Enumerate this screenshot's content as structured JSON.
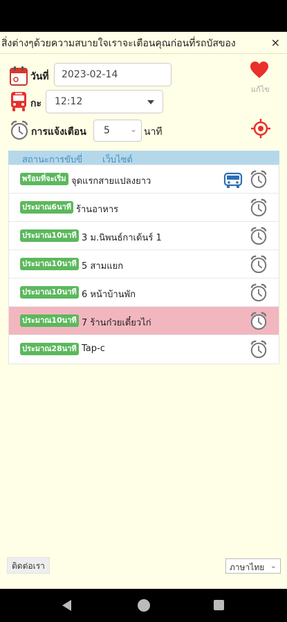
{
  "marquee": {
    "text": "สิ่งต่างๆด้วยความสบายใจเราจะเตือนคุณก่อนที่รถบัสของ",
    "close": "×"
  },
  "form": {
    "date_label": "วันที่",
    "date_value": "2023-02-14",
    "shift_label": "กะ",
    "shift_value": "12:12",
    "alert_label": "การแจ้งเตือน",
    "alert_value": "5",
    "alert_unit": "นาที"
  },
  "like": {
    "label": "แก้ไข"
  },
  "tabs": [
    "สถานะการขับขี่",
    "เว็บไซต์"
  ],
  "stops": [
    {
      "badge": "พร้อมที่จะเริ่ม",
      "name": "จุดแรกสายแปลงยาว",
      "bus": true,
      "highlight": false
    },
    {
      "badge": "ประมาณ6นาที",
      "name": "ร้านอาหาร",
      "bus": false,
      "highlight": false
    },
    {
      "badge": "ประมาณ10นาที",
      "name": "3 ม.นิพนธ์กาเด้นร์ 1",
      "bus": false,
      "highlight": false
    },
    {
      "badge": "ประมาณ10นาที",
      "name": "5 สามแยก",
      "bus": false,
      "highlight": false
    },
    {
      "badge": "ประมาณ10นาที",
      "name": "6 หน้าบ้านพัก",
      "bus": false,
      "highlight": false
    },
    {
      "badge": "ประมาณ10นาที",
      "name": "7 ร้านก๋วยเตี๋ยวไก่",
      "bus": false,
      "highlight": true
    },
    {
      "badge": "ประมาณ28นาที",
      "name": "Tap-c",
      "bus": false,
      "highlight": false
    }
  ],
  "footer": {
    "contact": "ติดต่อเรา",
    "language": "ภาษาไทย"
  },
  "colors": {
    "badge": "#5cb85c",
    "highlight": "#f2b6bf",
    "accent": "#e8302c",
    "tab_bar": "#b4d8ea"
  }
}
